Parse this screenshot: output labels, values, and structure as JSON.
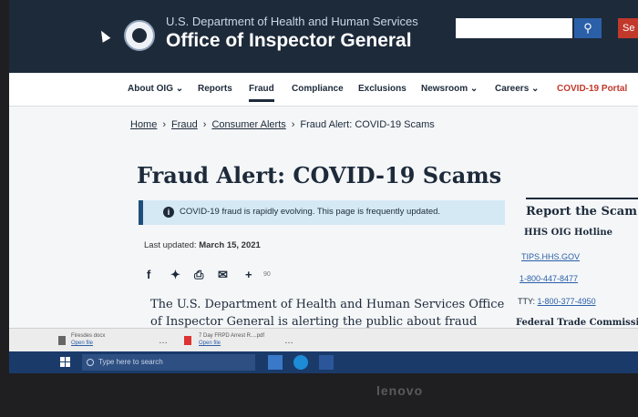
{
  "header": {
    "department": "U.S. Department of Health and Human Services",
    "office": "Office of Inspector General",
    "search_placeholder": "",
    "search_icon": "search-icon",
    "extra_button_label": "Se"
  },
  "nav": {
    "items": [
      {
        "label": "About OIG ⌄"
      },
      {
        "label": "Reports"
      },
      {
        "label": "Fraud"
      },
      {
        "label": "Compliance"
      },
      {
        "label": "Exclusions"
      },
      {
        "label": "Newsroom ⌄"
      },
      {
        "label": "Careers ⌄"
      },
      {
        "label": "COVID-19 Portal"
      }
    ],
    "active": "Fraud"
  },
  "breadcrumb": {
    "home": "Home",
    "fraud": "Fraud",
    "consumer": "Consumer Alerts",
    "current": "Fraud Alert: COVID-19 Scams"
  },
  "page": {
    "title": "Fraud Alert: COVID-19 Scams",
    "alert": "COVID-19 fraud is rapidly evolving. This page is frequently updated.",
    "updated_label": "Last updated:",
    "updated_date": "March 15, 2021",
    "share_count": "90",
    "body_line1": "The U.S. Department of Health and Human Services Office",
    "body_line2": "of Inspector General is alerting the public about fraud"
  },
  "sidebar": {
    "title": "Report the Scam",
    "hotline": "HHS OIG Hotline",
    "link1": "TIPS.HHS.GOV",
    "phone": "1-800-447-8477",
    "tty_label": "TTY:",
    "tty_number": "1-800-377-4950",
    "cut_text": "Federal Trade Commission"
  },
  "downloads": {
    "item1": "Firesdes docx",
    "item1_open": "Open file",
    "item2": "7 Day FRPD Arrest R....pdf",
    "item2_open": "Open file"
  },
  "taskbar": {
    "search_placeholder": "Type here to search"
  },
  "monitor": {
    "brand": "lenovo"
  },
  "colors": {
    "header_bg": "#1d2a3a",
    "accent": "#2b5fa8",
    "alert_bg": "#d5e9f5",
    "portal_red": "#c0392b"
  }
}
